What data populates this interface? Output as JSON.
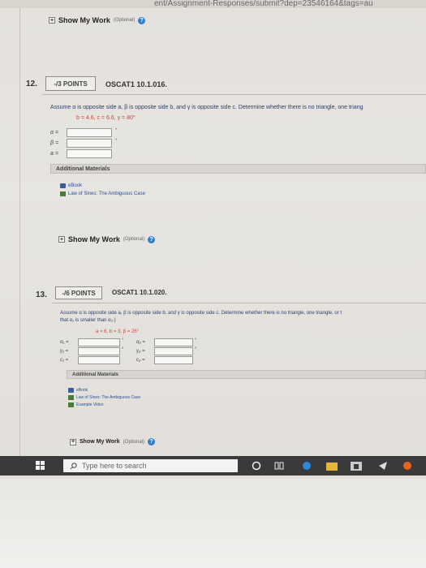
{
  "browser": {
    "url_fragment": "ent/Assignment-Responses/submit?dep=23546164&tags=au"
  },
  "show_my_work": {
    "label": "Show My Work",
    "optional": "(Optional)",
    "help": "?"
  },
  "questions": [
    {
      "number": "12.",
      "points": "-/3 POINTS",
      "title": "OSCAT1 10.1.016.",
      "text_line1": "Assume α is opposite side a, β is opposite side b, and γ is opposite side c. Determine whether there is no triangle, one triang",
      "given": "b = 4.6,   c = 6.6,   γ = 80°",
      "fields": [
        {
          "label": "α =",
          "unit": "°"
        },
        {
          "label": "β =",
          "unit": "°"
        },
        {
          "label": "a =",
          "unit": ""
        }
      ],
      "additional_materials": "Additional Materials",
      "materials": [
        {
          "icon": "book-icon",
          "label": "eBook"
        },
        {
          "icon": "document-icon",
          "label": "Law of Sines: The Ambiguous Case"
        }
      ]
    },
    {
      "number": "13.",
      "points": "-/6 POINTS",
      "title": "OSCAT1 10.1.020.",
      "text_line1": "Assume α is opposite side a, β is opposite side b, and γ is opposite side c. Determine whether there is no triangle, one triangle, or t",
      "text_line2": "that α₁ is smaller than α₂.)",
      "given": "a = 6,   b = 3,   β = 26°",
      "fields_left": [
        {
          "label": "α₁ =",
          "unit": "°"
        },
        {
          "label": "γ₁ =",
          "unit": "°"
        },
        {
          "label": "c₁ =",
          "unit": ""
        }
      ],
      "fields_right": [
        {
          "label": "α₂ =",
          "unit": "°"
        },
        {
          "label": "γ₂ =",
          "unit": "°"
        },
        {
          "label": "c₂ =",
          "unit": ""
        }
      ],
      "additional_materials": "Additional Materials",
      "materials": [
        {
          "icon": "book-icon",
          "label": "eBook"
        },
        {
          "icon": "document-icon",
          "label": "Law of Sines: The Ambiguous Case"
        },
        {
          "icon": "document-icon",
          "label": "Example Video"
        }
      ]
    }
  ],
  "taskbar": {
    "search_placeholder": "Type here to search"
  }
}
